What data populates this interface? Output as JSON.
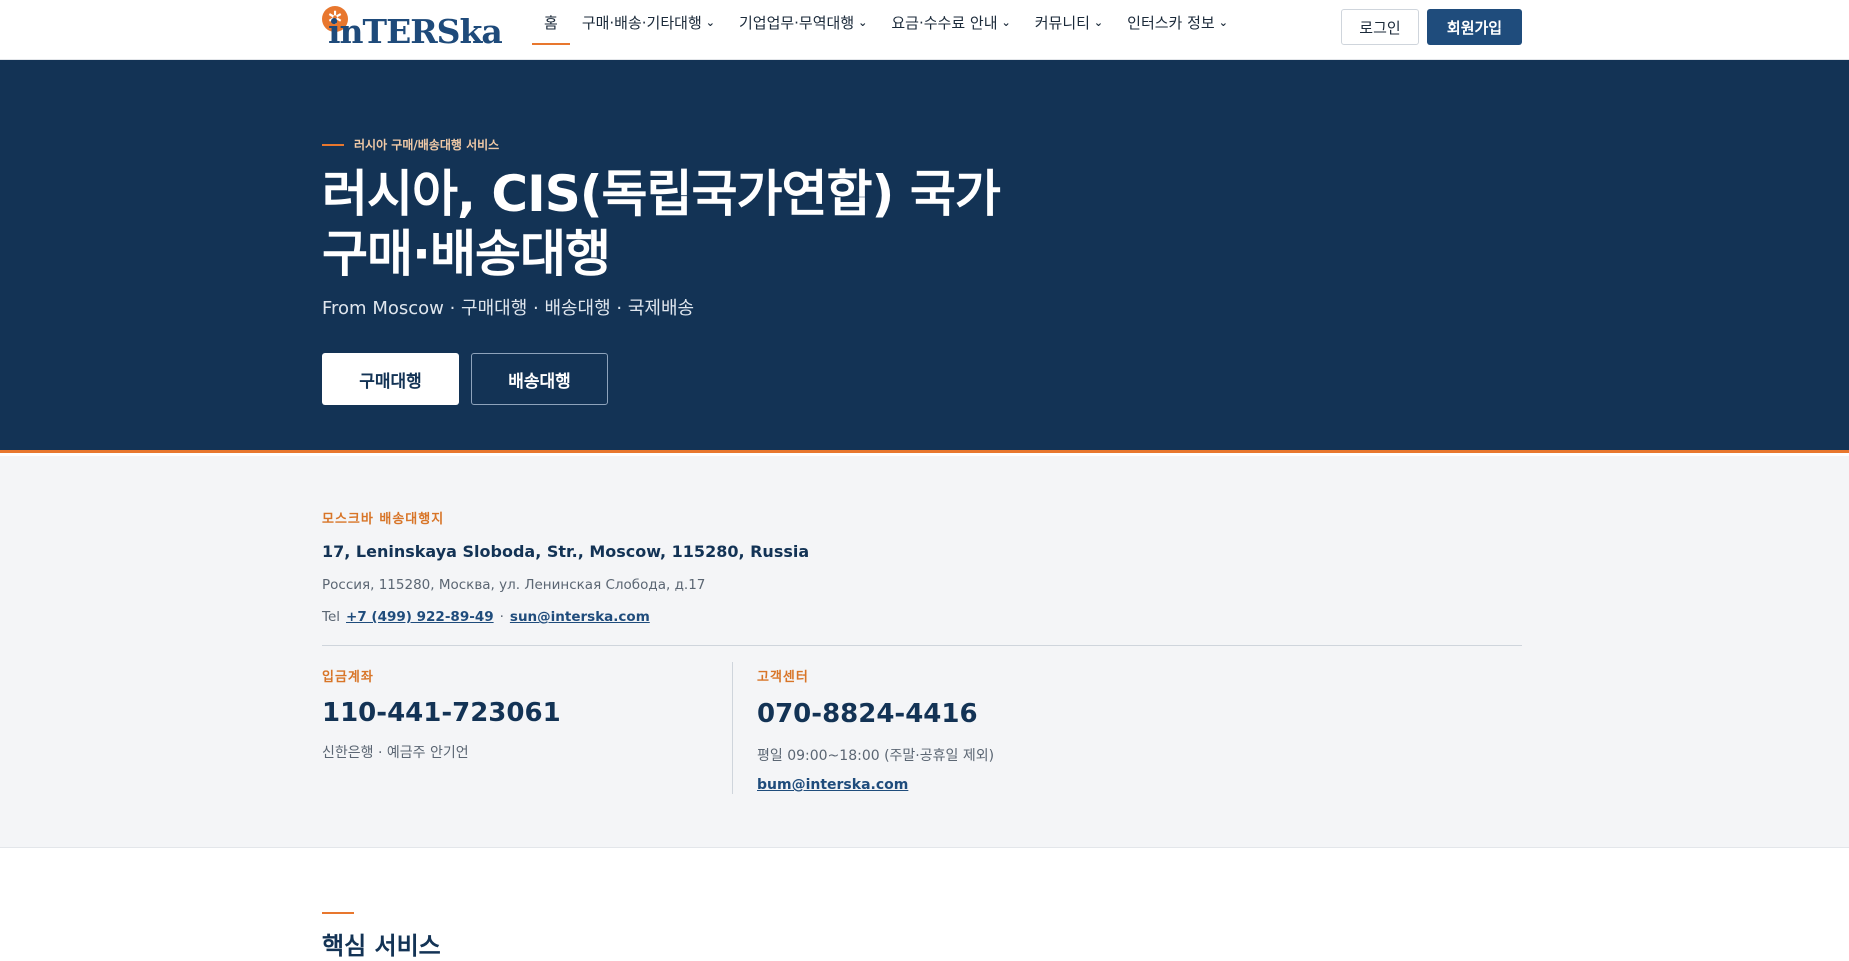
{
  "header": {
    "logo_text": "inTERSka",
    "logo_icon": "star-logo-icon",
    "nav": [
      {
        "label": "홈",
        "dropdown": false,
        "active": true
      },
      {
        "label": "구매·배송·기타대행",
        "dropdown": true
      },
      {
        "label": "기업업무·무역대행",
        "dropdown": true
      },
      {
        "label": "요금·수수료 안내",
        "dropdown": true
      },
      {
        "label": "커뮤니티",
        "dropdown": true
      },
      {
        "label": "인터스카 정보",
        "dropdown": true
      }
    ],
    "login_label": "로그인",
    "signup_label": "회원가입"
  },
  "hero": {
    "eyebrow": "러시아 구매/배송대행 서비스",
    "title_line1": "러시아, CIS(독립국가연합) 국가",
    "title_line2": "구매·배송대행",
    "subtitle": "From Moscow · 구매대행 · 배송대행 · 국제배송",
    "btn_purchase": "구매대행",
    "btn_shipping": "배송대행"
  },
  "info": {
    "address_label": "모스크바 배송대행지",
    "address_en": "17, Leninskaya Sloboda, Str., Moscow, 115280, Russia",
    "address_ru": "Россия, 115280, Москва, ул. Ленинская Слобода, д.17",
    "tel_prefix": "Tel",
    "tel": "+7 (499) 922-89-49",
    "separator": "·",
    "email": "sun@interska.com",
    "account_label": "입금계좌",
    "account_number": "110-441-723061",
    "account_note": "신한은행 · 예금주 안기언",
    "cs_label": "고객센터",
    "cs_phone": "070-8824-4416",
    "cs_hours": "평일 09:00~18:00 (주말·공휴일 제외)",
    "cs_email": "bum@interska.com"
  },
  "core": {
    "title": "핵심 서비스"
  },
  "colors": {
    "navy": "#133355",
    "accent": "#e8772e",
    "button_blue": "#1f4c7c"
  }
}
